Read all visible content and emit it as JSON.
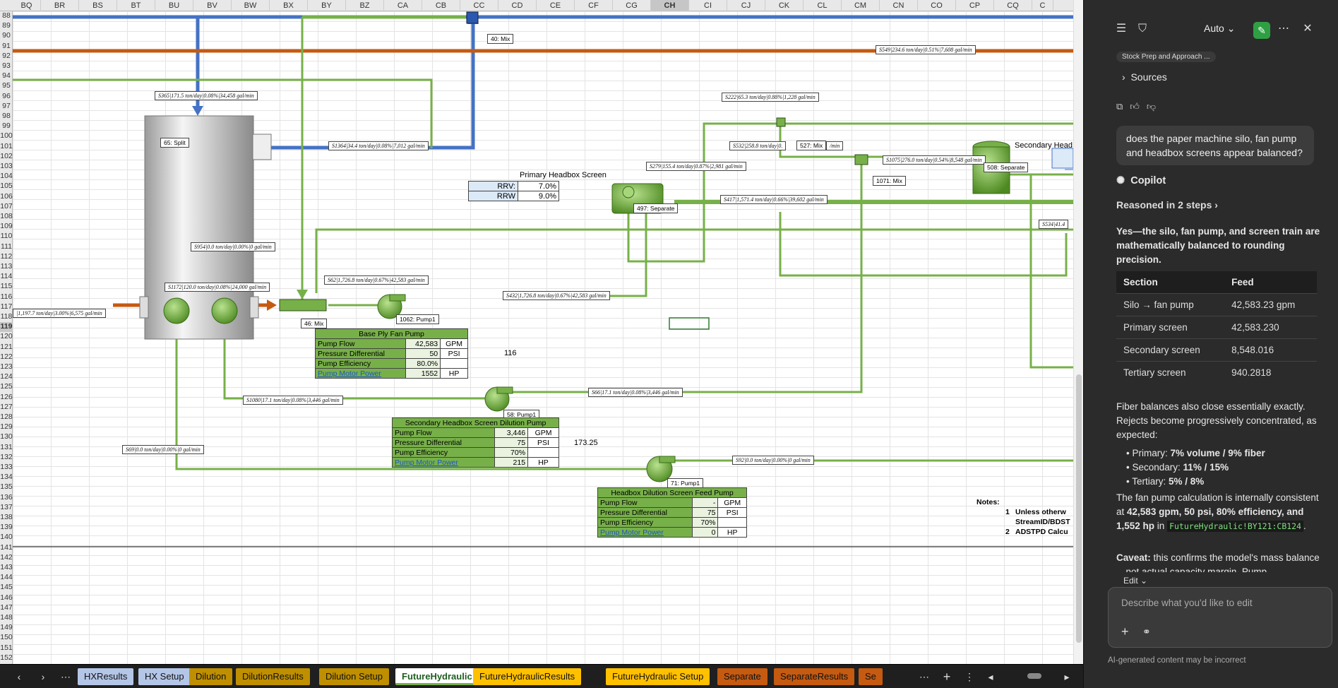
{
  "sheet": {
    "columns": [
      "BQ",
      "BR",
      "BS",
      "BT",
      "BU",
      "BV",
      "BW",
      "BX",
      "BY",
      "BZ",
      "CA",
      "CB",
      "CC",
      "CD",
      "CE",
      "CF",
      "CG",
      "CH",
      "CI",
      "CJ",
      "CK",
      "CL",
      "CM",
      "CN",
      "CO",
      "CP",
      "CQ",
      "C"
    ],
    "selected_column": "CH",
    "rows": [
      "88",
      "89",
      "90",
      "91",
      "92",
      "93",
      "94",
      "95",
      "96",
      "97",
      "98",
      "99",
      "100",
      "101",
      "102",
      "103",
      "104",
      "105",
      "106",
      "107",
      "108",
      "109",
      "110",
      "111",
      "112",
      "113",
      "114",
      "115",
      "116",
      "117",
      "118",
      "119",
      "120",
      "121",
      "122",
      "123",
      "124",
      "125",
      "126",
      "127",
      "128",
      "129",
      "130",
      "131",
      "132",
      "133",
      "134",
      "135",
      "136",
      "137",
      "138",
      "139",
      "140",
      "141",
      "142",
      "143",
      "144",
      "145",
      "146",
      "147",
      "148",
      "149",
      "150",
      "151",
      "152"
    ],
    "selected_row": "119",
    "stream_labels": {
      "s549": "S549|234.6 ton/day|0.51%|7,608 gal/min",
      "s365": "S365|171.5 ton/day|0.08%|34,458 gal/min",
      "s222": "S222|65.3 ton/day|0.88%|1,228 gal/min",
      "s1364": "S1364|34.4 ton/day|0.08%|7,012 gal/min",
      "s532": "S532|258.8 ton/day|0.",
      "s532_tail": "/min",
      "s1075": "S1075|276.0 ton/day|0.54%|8,548 gal/min",
      "s279": "S279|155.4 ton/day|0.87%|2,981 gal/min",
      "s417": "S417|1,571.4 ton/day|0.66%|39,602 gal/min",
      "s534": "S534|41.4",
      "s954": "S954|0.0 ton/day|0.00%|0 gal/min",
      "s62": "S62|1,726.8 ton/day|0.67%|42,583 gal/min",
      "s1172": "S1172|120.0 ton/day|0.08%|24,000 gal/min",
      "s432": "S432|1,726.8 ton/day|0.67%|42,583 gal/min",
      "s_left": "|1,197.7 ton/day|3.00%|6,575 gal/min",
      "s1080": "S1080|17.1 ton/day|0.08%|3,446 gal/min",
      "s66": "S66|17.1 ton/day|0.08%|3,446 gal/min",
      "s69": "S69|0.0 ton/day|0.00%|0 gal/min",
      "s92": "S92|0.0 ton/day|0.00%|0 gal/min"
    },
    "nodes": {
      "n40": "40: Mix",
      "n65": "65: Split",
      "n527": "527: Mix",
      "n1071": "1071: Mix",
      "n508": "508: Separate",
      "n497": "497: Separate",
      "n46": "46: Mix",
      "n1062": "1062: Pump1",
      "n58": "58: Pump1",
      "n71": "71: Pump1"
    },
    "primary_screen": {
      "title": "Primary Headbox Screen",
      "rrv_label": "RRV:",
      "rrv": "7.0%",
      "rrw_label": "RRW",
      "rrw": "9.0%"
    },
    "secondary_heading": "Secondary Head",
    "pump_tables": [
      {
        "title": "Base Ply Fan Pump",
        "rows": [
          [
            "Pump Flow",
            "42,583",
            "GPM"
          ],
          [
            "Pressure Differential",
            "50",
            "PSI"
          ],
          [
            "Pump Efficiency",
            "80.0%",
            ""
          ],
          [
            "Pump Motor Power",
            "1552",
            "HP"
          ]
        ]
      },
      {
        "title": "Secondary Headbox Screen Dilution Pump",
        "rows": [
          [
            "Pump Flow",
            "3,446",
            "GPM"
          ],
          [
            "Pressure Differential",
            "75",
            "PSI"
          ],
          [
            "Pump Efficiency",
            "70%",
            ""
          ],
          [
            "Pump Motor Power",
            "215",
            "HP"
          ]
        ]
      },
      {
        "title": "Headbox Dilution Screen Feed Pump",
        "rows": [
          [
            "Pump Flow",
            "-",
            "GPM"
          ],
          [
            "Pressure Differential",
            "75",
            "PSI"
          ],
          [
            "Pump Efficiency",
            "70%",
            ""
          ],
          [
            "Pump Motor Power",
            "0",
            "HP"
          ]
        ]
      }
    ],
    "cells": {
      "c116": "116",
      "c173": "173.25"
    },
    "notes": {
      "title": "Notes:",
      "n1": "1",
      "n1_text": "Unless otherw",
      "n1_text2": "StreamID/BDST",
      "n2": "2",
      "n2_text": "ADSTPD Calcu"
    }
  },
  "tabs": {
    "items": [
      {
        "label": "HXResults",
        "color": "#b4c6e7"
      },
      {
        "label": "HX Setup",
        "color": "#b4c6e7"
      },
      {
        "label": "Dilution",
        "color": "#bf8f00"
      },
      {
        "label": "DilutionResults",
        "color": "#bf8f00"
      },
      {
        "label": "Dilution Setup",
        "color": "#bf8f00"
      },
      {
        "label": "FutureHydraulic",
        "color": "#ffffff"
      },
      {
        "label": "FutureHydraulicResults",
        "color": "#ffc000"
      },
      {
        "label": "FutureHydraulic Setup",
        "color": "#ffc000"
      },
      {
        "label": "Separate",
        "color": "#c55a11"
      },
      {
        "label": "SeparateResults",
        "color": "#c55a11"
      },
      {
        "label": "Se",
        "color": "#c55a11"
      }
    ],
    "active": "FutureHydraulic"
  },
  "copilot": {
    "mode": "Auto",
    "source_chip": "Stock Prep and Approach ...",
    "sources_label": "Sources",
    "user_question": "does the paper machine silo, fan pump and headbox screens appear balanced?",
    "assistant_name": "Copilot",
    "reasoned": "Reasoned in 2 steps",
    "answer_intro": "Yes—the silo, fan pump, and screen train are mathematically balanced to rounding precision.",
    "table_headers": [
      "Section",
      "Feed"
    ],
    "table_rows": [
      [
        "Silo → fan pump",
        "42,583.23 gpm"
      ],
      [
        "Primary screen",
        "42,583.230"
      ],
      [
        "Secondary screen",
        "8,548.016"
      ],
      [
        "Tertiary screen",
        "940.2818"
      ]
    ],
    "fiber_text": "Fiber balances also close essentially exactly. Rejects become progressively concentrated, as expected:",
    "bullets": [
      {
        "label": "Primary:",
        "value": "7% volume / 9% fiber"
      },
      {
        "label": "Secondary:",
        "value": "11% / 15%"
      },
      {
        "label": "Tertiary:",
        "value": "5% / 8%"
      }
    ],
    "fan_text_1": "The fan pump calculation is internally consistent at",
    "fan_bold": "42,583 gpm, 50 psi, 80% efficiency, and 1,552 hp",
    "fan_text_2": "in",
    "fan_code": "FutureHydraulic!BY121:CB124",
    "caveat_label": "Caveat:",
    "caveat_text": "this confirms the model's mass balance—not actual capacity margin. Pump",
    "edit_label": "Edit",
    "edit_placeholder": "Describe what you'd like to edit",
    "disclaimer": "AI-generated content may be incorrect"
  },
  "colors": {
    "green_pipe": "#77b049",
    "blue_pipe": "#4472c4",
    "orange_pipe": "#c55a11",
    "panel_bg": "#2b2b2b",
    "copilot_green": "#2ea043"
  }
}
